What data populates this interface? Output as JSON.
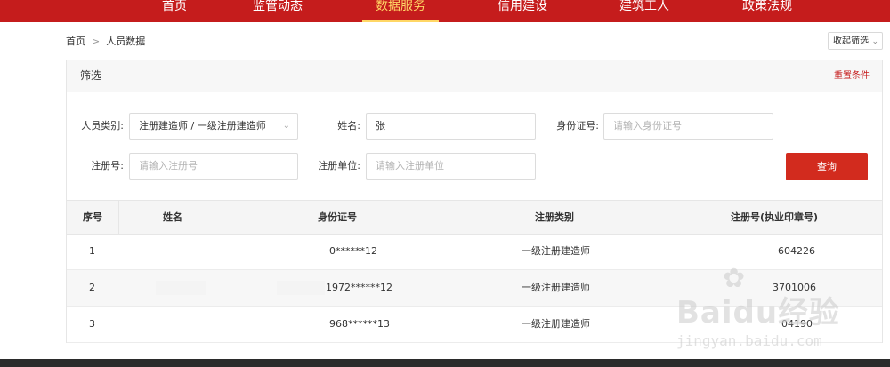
{
  "nav": {
    "items": [
      {
        "label": "首页"
      },
      {
        "label": "监管动态"
      },
      {
        "label": "数据服务"
      },
      {
        "label": "信用建设"
      },
      {
        "label": "建筑工人"
      },
      {
        "label": "政策法规"
      }
    ],
    "active": "数据服务"
  },
  "breadcrumb": {
    "home": "首页",
    "current": "人员数据"
  },
  "collapse_button": {
    "label": "收起筛选"
  },
  "filter": {
    "title": "筛选",
    "reset": "重置条件",
    "person_type": {
      "label": "人员类别:",
      "value": "注册建造师 / 一级注册建造师"
    },
    "name": {
      "label": "姓名:",
      "value": "张"
    },
    "id_number": {
      "label": "身份证号:",
      "placeholder": "请输入身份证号"
    },
    "reg_number": {
      "label": "注册号:",
      "placeholder": "请输入注册号"
    },
    "reg_unit": {
      "label": "注册单位:",
      "placeholder": "请输入注册单位"
    },
    "query_button": "查询"
  },
  "table": {
    "headers": {
      "index": "序号",
      "name": "姓名",
      "id_number": "身份证号",
      "reg_type": "注册类别",
      "reg_number": "注册号(执业印章号)"
    },
    "rows": [
      {
        "index": "1",
        "id_number": "0******12",
        "reg_type": "一级注册建造师",
        "reg_number": "604226"
      },
      {
        "index": "2",
        "id_number": "1972******12",
        "reg_type": "一级注册建造师",
        "reg_number": "3701006"
      },
      {
        "index": "3",
        "id_number": "968******13",
        "reg_type": "一级注册建造师",
        "reg_number": "04190"
      }
    ]
  },
  "watermark": {
    "brand": "Baidu经验",
    "url": "jingyan.baidu.com"
  },
  "colors": {
    "brand_red": "#c51c1c",
    "active_nav": "#ffd766",
    "query_button": "#d22b1e"
  }
}
